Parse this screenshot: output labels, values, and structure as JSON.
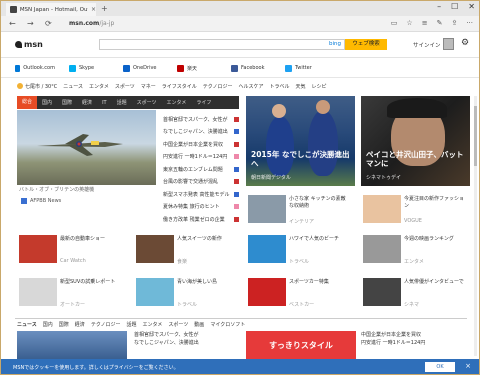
{
  "browser": {
    "tab_title": "MSN Japan - Hotmail, Out",
    "address": "msn.com",
    "address_path": "/ja-jp"
  },
  "header": {
    "logo": "msn",
    "bing": "bing",
    "search_button": "ウェブ検索",
    "signin": "サインイン"
  },
  "quicklinks": [
    {
      "label": "Outlook.com",
      "color": "#0078d7"
    },
    {
      "label": "Skype",
      "color": "#00aff0"
    },
    {
      "label": "OneDrive",
      "color": "#0a62c9"
    },
    {
      "label": "楽天",
      "color": "#bf0000"
    },
    {
      "label": "Facebook",
      "color": "#3b5998"
    },
    {
      "label": "Twitter",
      "color": "#1da1f2"
    }
  ],
  "weather": "七尾市 / 30°C",
  "categories": [
    "ニュース",
    "エンタメ",
    "スポーツ",
    "マネー",
    "ライフスタイル",
    "テクノロジー",
    "ヘルスケア",
    "トラベル",
    "天気",
    "レシピ"
  ],
  "main_tabs": [
    "総合",
    "国内",
    "国際",
    "経済",
    "IT",
    "話題",
    "スポーツ",
    "エンタメ",
    "ライフ"
  ],
  "hero": {
    "caption": "バトル・オブ・ブリテンの英雄機",
    "source": "AFPBB News"
  },
  "headlines": [
    "首相官邸でスパーク、女性が",
    "なでしこジャパン、決勝進出",
    "中国企業が日本企業を買収",
    "円安進行 一時1ドル＝124円",
    "東京五輪のエンブレム問題",
    "台風の影響で交通が混乱",
    "新型スマホ発表 高性能モデル",
    "夏休み特集 旅行のヒント",
    "働き方改革 残業ゼロの企業"
  ],
  "feature1": {
    "title": "2015年 なでしこが決勝進出へ",
    "source": "朝日新聞デジタル"
  },
  "feature2": {
    "title": "ペイコと井沢山田子、バットマンに",
    "source": "シネマトゥデイ"
  },
  "cards": [
    {
      "text": "小さな家 キッチンの素敵な収納術",
      "source": "インテリア"
    },
    {
      "text": "今夏注目の新作ファッション",
      "source": "VOGUE"
    },
    {
      "text": "最新の自動車ショー",
      "source": "Car Watch"
    },
    {
      "text": "人気スイーツの新作",
      "source": "食楽"
    },
    {
      "text": "ハワイで人気のビーチ",
      "source": "トラベル"
    },
    {
      "text": "今週の映画ランキング",
      "source": "エンタメ"
    },
    {
      "text": "新型SUVの試乗レポート",
      "source": "オートカー"
    },
    {
      "text": "青い海が美しい島",
      "source": "トラベル"
    },
    {
      "text": "スポーツカー特集",
      "source": "ベストカー"
    },
    {
      "text": "人気俳優がインタビューで",
      "source": "シネマ"
    }
  ],
  "bottom_tabs": [
    "ニュース",
    "国内",
    "国際",
    "経済",
    "テクノロジー",
    "話題",
    "エンタメ",
    "スポーツ",
    "動画",
    "マイクロソフト"
  ],
  "bottom_feature": "すっきりスタイル",
  "footer": {
    "text": "MSNではクッキーを使用します。詳しくはプライバシーをご覧ください。",
    "ok": "OK"
  }
}
